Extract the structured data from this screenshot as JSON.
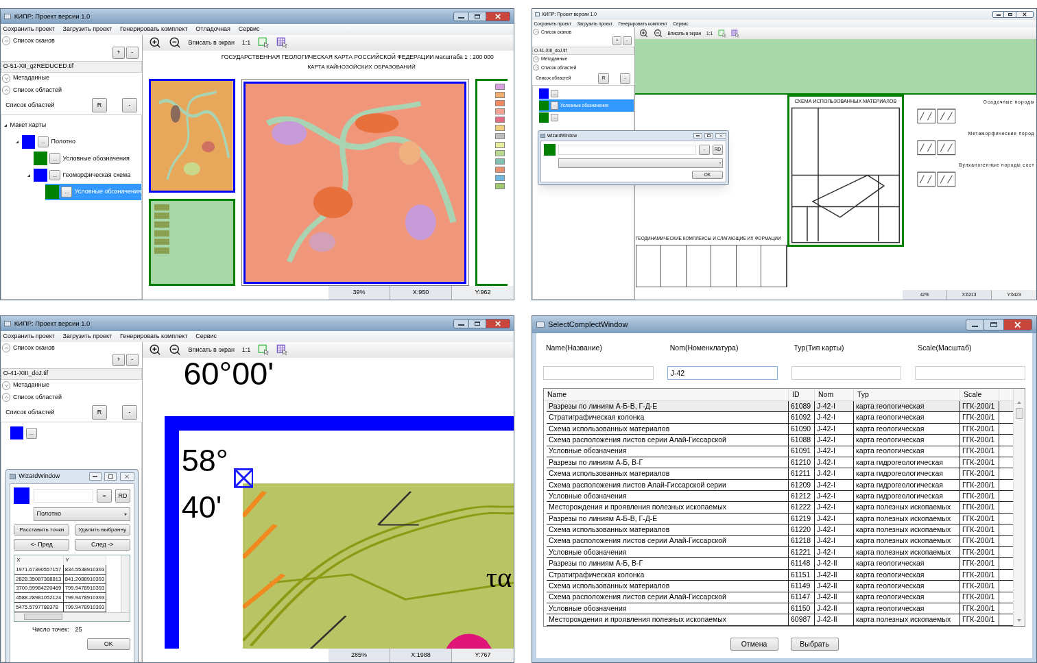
{
  "screens": [
    {
      "kind": "main",
      "title": "КИПР: Проект версии 1.0",
      "active": true,
      "menu": [
        "Сохранить проект",
        "Загрузить проект",
        "Генерировать комплект",
        "Отладочная",
        "Сервис"
      ],
      "scans": {
        "label": "Список сканов",
        "expanded": true,
        "add": "+",
        "remove": "-",
        "file": "O-51-XII_gzREDUCED.tif"
      },
      "metadata": {
        "label": "Метаданные",
        "expanded": false
      },
      "regions": {
        "label": "Список областей",
        "expanded": true,
        "title": "Список областей",
        "r_button": "R",
        "remove": "-",
        "tree": [
          {
            "label": "Макет карты",
            "expanded": true,
            "selected": false,
            "children": [
              {
                "color": "#0000ff",
                "button": "...",
                "label": "Полотно",
                "expanded": true,
                "selected": false,
                "children": [
                  {
                    "color": "#008000",
                    "button": "...",
                    "label": "Условные обозначения",
                    "selected": false
                  },
                  {
                    "color": "#0000ff",
                    "button": "...",
                    "label": "Геоморфическая схема",
                    "expanded": true,
                    "selected": false,
                    "children": [
                      {
                        "color": "#008000",
                        "button": "...",
                        "label": "Условные обозначения",
                        "selected": true
                      }
                    ]
                  }
                ]
              }
            ]
          }
        ]
      },
      "toolbar": {
        "fit": "Вписать в экран",
        "actual": "1:1"
      },
      "canvas": {
        "kind": "overview",
        "labels": [
          "ГОСУДАРСТВЕННАЯ ГЕОЛОГИЧЕСКАЯ КАРТА РОССИЙСКОЙ ФЕДЕРАЦИИ масштаба 1 : 200 000",
          "КАРТА КАЙНОЗОЙСКИХ ОБРАЗОВАНИЙ"
        ]
      },
      "status": {
        "zoom": "39%",
        "x": "X:950",
        "y": "Y:962"
      }
    },
    {
      "kind": "main",
      "title": "КИПР: Проект версии 1.0",
      "active": false,
      "menu": [
        "Сохранить проект",
        "Загрузить проект",
        "Генерировать комплект",
        "Сервис"
      ],
      "scans": {
        "label": "Список сканов",
        "expanded": true,
        "add": "+",
        "remove": "-",
        "file": "O-41-XIII_doJ.tif"
      },
      "metadata": {
        "label": "Метаданные",
        "expanded": false
      },
      "regions": {
        "label": "Список областей",
        "expanded": true,
        "title": "Список областей",
        "r_button": "R",
        "remove": "-",
        "tree": [
          {
            "color": "#0000ff",
            "button": "...",
            "selected": false
          },
          {
            "color": "#008000",
            "button": "...",
            "label": "Условные обозначения",
            "selected": true
          },
          {
            "color": "#008000",
            "button": "...",
            "selected": false
          }
        ]
      },
      "toolbar": {
        "fit": "Вписать в экран",
        "actual": "1:1"
      },
      "canvas": {
        "kind": "legend_sheet",
        "labels": [
          "СХЕМА ИСПОЛЬЗОВАННЫХ МАТЕРИАЛОВ",
          "Осадочные породы",
          "Метаморфические пород",
          "Вулканогенные породы сост",
          "ГЕОДИНАМИЧЕСКИЕ КОМПЛЕКСЫ И СЛАГАЮЩИЕ ИХ ФОРМАЦИИ"
        ]
      },
      "status": {
        "zoom": "42%",
        "x": "X:6213",
        "y": "Y:6423"
      },
      "wizard": {
        "title": "WizardWindow",
        "color": "#008000",
        "eq_button": "-",
        "rd_button": "RD",
        "ok": "OK"
      }
    },
    {
      "kind": "main",
      "title": "КИПР: Проект версии 1.0",
      "active": true,
      "menu": [
        "Сохранить проект",
        "Загрузить проект",
        "Генерировать комплект",
        "Сервис"
      ],
      "scans": {
        "label": "Список сканов",
        "expanded": true,
        "add": "+",
        "remove": "-",
        "file": "O-41-XIII_doJ.tif"
      },
      "metadata": {
        "label": "Метаданные",
        "expanded": false
      },
      "regions": {
        "label": "Список областей",
        "expanded": true,
        "title": "Список областей",
        "r_button": "R",
        "remove": "-",
        "tree": [
          {
            "color": "#0000ff",
            "button": "...",
            "selected": false
          }
        ]
      },
      "toolbar": {
        "fit": "Вписать в экран",
        "actual": "1:1"
      },
      "canvas": {
        "kind": "zoomed",
        "labels": [
          "60°00'",
          "58°",
          "40'",
          "τα"
        ]
      },
      "status": {
        "zoom": "285%",
        "x": "X:1988",
        "y": "Y:767"
      },
      "wizard": {
        "title": "WizardWindow",
        "color": "#0000ff",
        "eq_button": "=",
        "rd_button": "RD",
        "dropdown": "Полотно",
        "actions": [
          "Расставить точки",
          "Удалить выбранну"
        ],
        "nav": [
          "<- Пред",
          "След ->"
        ],
        "points": {
          "columns": [
            "X",
            "Y"
          ],
          "rows": [
            [
              "1971.67390557157",
              "834.5538910393"
            ],
            [
              "2828.35087388813",
              "841.2088910393"
            ],
            [
              "3700.99984220469",
              "799.9478910393"
            ],
            [
              "4588.28981052124",
              "799.9478910393"
            ],
            [
              "5475.5797788378",
              "799.9478910393"
            ]
          ]
        },
        "count_label": "Число точек:",
        "count": "25",
        "ok": "OK"
      }
    },
    {
      "kind": "select",
      "title": "SelectComplectWindow",
      "filters": [
        {
          "label": "Name(Название)"
        },
        {
          "label": "Nom(Номенклатура)",
          "value": "J-42"
        },
        {
          "label": "Typ(Тип карты)"
        },
        {
          "label": "Scale(Масштаб)"
        }
      ],
      "table": {
        "columns": [
          "Name",
          "ID",
          "Nom",
          "Typ",
          "Scale"
        ],
        "rows": [
          {
            "cells": [
              "Разрезы по линиям А-Б-В, Г-Д-Е",
              "61089",
              "J-42-I",
              "карта геологическая",
              "ГГК-200/1"
            ],
            "selected": true
          },
          {
            "cells": [
              "Стратиграфическая колонка",
              "61092",
              "J-42-I",
              "карта геологическая",
              "ГГК-200/1"
            ],
            "selected": false
          },
          {
            "cells": [
              "Схема использованных материалов",
              "61090",
              "J-42-I",
              "карта геологическая",
              "ГГК-200/1"
            ],
            "selected": false
          },
          {
            "cells": [
              "Схема расположения листов серии Алай-Гиссарской",
              "61088",
              "J-42-I",
              "карта геологическая",
              "ГГК-200/1"
            ],
            "selected": false
          },
          {
            "cells": [
              "Условные обозначения",
              "61091",
              "J-42-I",
              "карта геологическая",
              "ГГК-200/1"
            ],
            "selected": false
          },
          {
            "cells": [
              "Разрезы по линиям А-Б, В-Г",
              "61210",
              "J-42-I",
              "карта гидрогеологическая",
              "ГГК-200/1"
            ],
            "selected": false
          },
          {
            "cells": [
              "Схема использованных материалов",
              "61211",
              "J-42-I",
              "карта гидрогеологическая",
              "ГГК-200/1"
            ],
            "selected": false
          },
          {
            "cells": [
              "Схема расположения листов Алай-Гиссарской серии",
              "61209",
              "J-42-I",
              "карта гидрогеологическая",
              "ГГК-200/1"
            ],
            "selected": false
          },
          {
            "cells": [
              "Условные обозначения",
              "61212",
              "J-42-I",
              "карта гидрогеологическая",
              "ГГК-200/1"
            ],
            "selected": false
          },
          {
            "cells": [
              "Месторождения и проявления полезных ископаемых",
              "61222",
              "J-42-I",
              "карта полезных ископаемых",
              "ГГК-200/1"
            ],
            "selected": false
          },
          {
            "cells": [
              "Разрезы по линиям А-Б-В, Г-Д-Е",
              "61219",
              "J-42-I",
              "карта полезных ископаемых",
              "ГГК-200/1"
            ],
            "selected": false
          },
          {
            "cells": [
              "Схема использованных материалов",
              "61220",
              "J-42-I",
              "карта полезных ископаемых",
              "ГГК-200/1"
            ],
            "selected": false
          },
          {
            "cells": [
              "Схема расположения листов серии Алай-Гиссарской",
              "61218",
              "J-42-I",
              "карта полезных ископаемых",
              "ГГК-200/1"
            ],
            "selected": false
          },
          {
            "cells": [
              "Условные обозначения",
              "61221",
              "J-42-I",
              "карта полезных ископаемых",
              "ГГК-200/1"
            ],
            "selected": false
          },
          {
            "cells": [
              "Разрезы по линиям А-Б, В-Г",
              "61148",
              "J-42-II",
              "карта геологическая",
              "ГГК-200/1"
            ],
            "selected": false
          },
          {
            "cells": [
              "Стратиграфическая колонка",
              "61151",
              "J-42-II",
              "карта геологическая",
              "ГГК-200/1"
            ],
            "selected": false
          },
          {
            "cells": [
              "Схема использованных материалов",
              "61149",
              "J-42-II",
              "карта геологическая",
              "ГГК-200/1"
            ],
            "selected": false
          },
          {
            "cells": [
              "Схема расположения листов серии Алай-Гиссарской",
              "61147",
              "J-42-II",
              "карта геологическая",
              "ГГК-200/1"
            ],
            "selected": false
          },
          {
            "cells": [
              "Условные обозначения",
              "61150",
              "J-42-II",
              "карта геологическая",
              "ГГК-200/1"
            ],
            "selected": false
          },
          {
            "cells": [
              "Месторождения и проявления полезных ископаемых",
              "60987",
              "J-42-II",
              "карта полезных ископаемых",
              "ГГК-200/1"
            ],
            "selected": false
          }
        ]
      },
      "buttons": [
        "Отмена",
        "Выбрать"
      ]
    }
  ]
}
